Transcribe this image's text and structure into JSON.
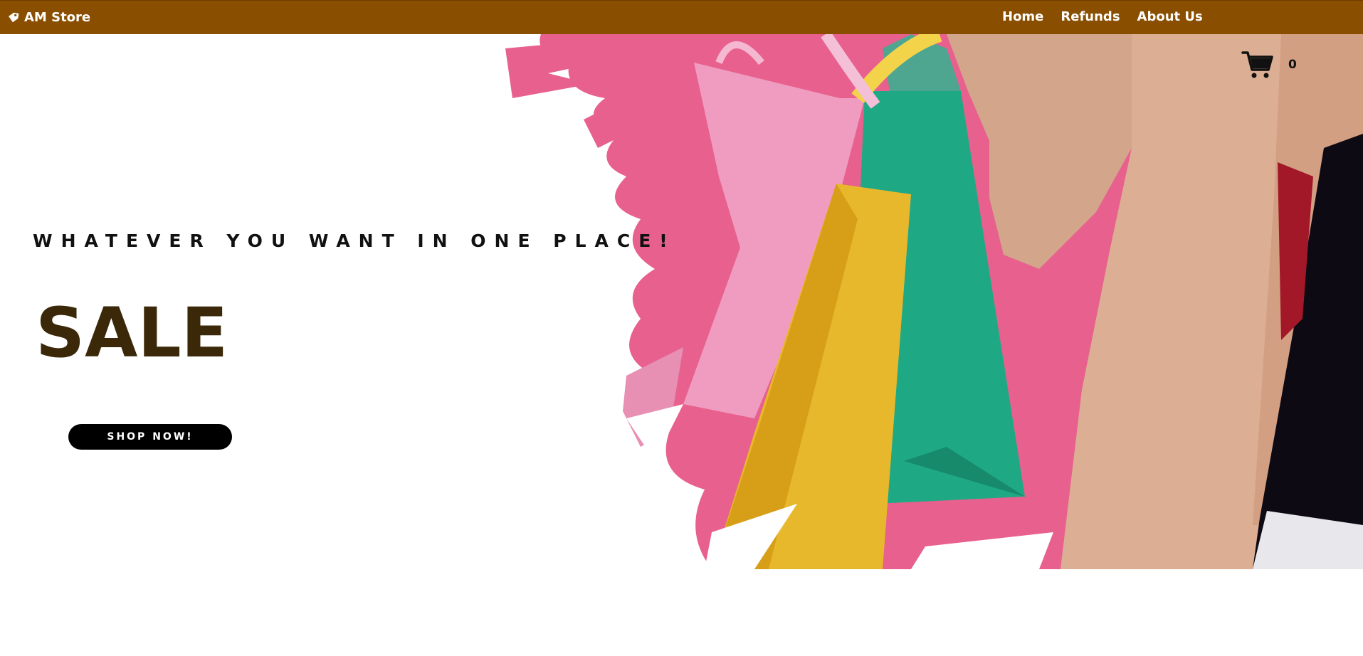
{
  "navbar": {
    "brand": "AM Store",
    "brand_icon": "tag-icon",
    "links": [
      {
        "label": "Home"
      },
      {
        "label": "Refunds"
      },
      {
        "label": "About Us"
      }
    ]
  },
  "hero": {
    "tagline": "WHATEVER YOU WANT IN ONE PLACE!",
    "title": "SALE",
    "cta": "SHOP NOW!",
    "cart_icon": "cart-icon",
    "cart_count": "0"
  },
  "colors": {
    "navbar": "#8a4e00",
    "title": "#3a2808",
    "button": "#000000",
    "pink": "#e8608e",
    "yellow": "#e8b82c",
    "green": "#1fa884",
    "coat": "#d9a98c"
  }
}
